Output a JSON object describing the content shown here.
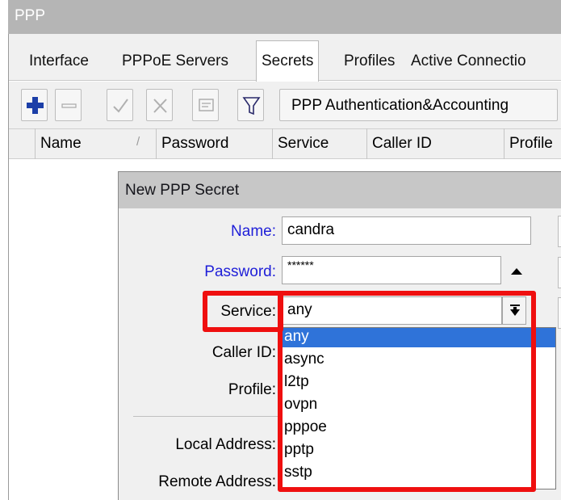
{
  "window": {
    "title": "PPP"
  },
  "tabs": [
    "Interface",
    "PPPoE Servers",
    "Secrets",
    "Profiles",
    "Active Connectio"
  ],
  "active_tab": "Secrets",
  "toolbar": {
    "auth_button_label": "PPP Authentication&Accounting"
  },
  "table": {
    "columns": [
      "Name",
      "Password",
      "Service",
      "Caller ID",
      "Profile"
    ],
    "sort_indicator": "/"
  },
  "dialog": {
    "title": "New PPP Secret",
    "fields": {
      "name": {
        "label": "Name:",
        "value": "candra"
      },
      "password": {
        "label": "Password:",
        "value": "******"
      },
      "service": {
        "label": "Service:",
        "value": "any"
      },
      "caller_id": {
        "label": "Caller ID:"
      },
      "profile": {
        "label": "Profile:"
      },
      "local_address": {
        "label": "Local Address:"
      },
      "remote_address": {
        "label": "Remote Address:"
      }
    },
    "service_options": [
      "any",
      "async",
      "l2tp",
      "ovpn",
      "pppoe",
      "pptp",
      "sstp"
    ],
    "service_selected": "any"
  },
  "colors": {
    "highlight": "#ef0f0f",
    "selection": "#2f73d9",
    "blue_label": "#1e1ed8"
  }
}
